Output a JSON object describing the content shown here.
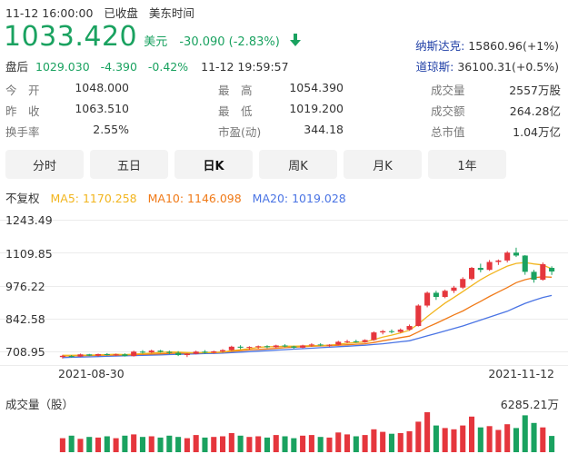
{
  "header": {
    "datetime": "11-12 16:00:00",
    "market_status": "已收盘",
    "timezone": "美东时间",
    "price": "1033.420",
    "currency": "美元",
    "change": "-30.090 (-2.83%)",
    "after_label": "盘后",
    "after_price": "1029.030",
    "after_change": "-4.390",
    "after_pct": "-0.42%",
    "after_time": "11-12 19:59:57"
  },
  "indices": [
    {
      "name": "纳斯达克:",
      "value": "15860.96(+1%)"
    },
    {
      "name": "道琼斯:",
      "value": "36100.31(+0.5%)"
    }
  ],
  "stats": {
    "open_label": "今　开",
    "open": "1048.000",
    "high_label": "最　高",
    "high": "1054.390",
    "volume_label": "成交量",
    "volume": "2557万股",
    "prev_label": "昨　收",
    "prev": "1063.510",
    "low_label": "最　低",
    "low": "1019.200",
    "amount_label": "成交额",
    "amount": "264.28亿",
    "turnover_label": "换手率",
    "turnover": "2.55%",
    "pe_label": "市盈(动)",
    "pe": "344.18",
    "mcap_label": "总市值",
    "mcap": "1.04万亿"
  },
  "tabs": [
    "分时",
    "五日",
    "日K",
    "周K",
    "月K",
    "1年"
  ],
  "active_tab": "日K",
  "ma_bar": {
    "adjust": "不复权",
    "ma5": "MA5: 1170.258",
    "ma10": "MA10: 1146.098",
    "ma20": "MA20: 1019.028"
  },
  "colors": {
    "up": "#e5363d",
    "down": "#1aa260",
    "ma5": "#f2b51e",
    "ma10": "#f07a18",
    "ma20": "#4a74e4"
  },
  "chart_data": {
    "type": "candlestick",
    "y_ticks": [
      "1243.49",
      "1109.85",
      "976.22",
      "842.58",
      "708.95"
    ],
    "x_labels": [
      "2021-08-30",
      "2021-11-12"
    ],
    "ylim": [
      708.95,
      1243.49
    ],
    "candles": [
      [
        686,
        695,
        680,
        691
      ],
      [
        690,
        694,
        684,
        688
      ],
      [
        688,
        700,
        686,
        697
      ],
      [
        697,
        699,
        690,
        692
      ],
      [
        692,
        700,
        688,
        698
      ],
      [
        698,
        702,
        692,
        695
      ],
      [
        695,
        700,
        690,
        697
      ],
      [
        697,
        701,
        688,
        690
      ],
      [
        690,
        712,
        688,
        708
      ],
      [
        708,
        714,
        700,
        705
      ],
      [
        705,
        716,
        702,
        712
      ],
      [
        712,
        715,
        704,
        707
      ],
      [
        707,
        712,
        698,
        703
      ],
      [
        703,
        710,
        690,
        694
      ],
      [
        694,
        702,
        686,
        699
      ],
      [
        699,
        712,
        697,
        708
      ],
      [
        708,
        714,
        700,
        704
      ],
      [
        704,
        712,
        700,
        709
      ],
      [
        709,
        718,
        704,
        714
      ],
      [
        714,
        732,
        711,
        728
      ],
      [
        728,
        734,
        718,
        724
      ],
      [
        724,
        730,
        716,
        727
      ],
      [
        727,
        733,
        720,
        730
      ],
      [
        730,
        734,
        722,
        726
      ],
      [
        726,
        736,
        722,
        733
      ],
      [
        733,
        738,
        726,
        729
      ],
      [
        729,
        732,
        720,
        724
      ],
      [
        724,
        736,
        722,
        733
      ],
      [
        733,
        742,
        728,
        737
      ],
      [
        737,
        742,
        730,
        734
      ],
      [
        734,
        738,
        728,
        736
      ],
      [
        736,
        752,
        733,
        748
      ],
      [
        748,
        756,
        742,
        750
      ],
      [
        750,
        756,
        744,
        747
      ],
      [
        747,
        758,
        744,
        755
      ],
      [
        755,
        790,
        752,
        786
      ],
      [
        786,
        796,
        778,
        791
      ],
      [
        791,
        798,
        782,
        788
      ],
      [
        788,
        802,
        784,
        797
      ],
      [
        797,
        818,
        793,
        812
      ],
      [
        812,
        900,
        810,
        895
      ],
      [
        895,
        952,
        888,
        947
      ],
      [
        947,
        955,
        918,
        930
      ],
      [
        930,
        960,
        925,
        955
      ],
      [
        955,
        975,
        946,
        968
      ],
      [
        968,
        1010,
        962,
        1003
      ],
      [
        1003,
        1052,
        998,
        1048
      ],
      [
        1048,
        1065,
        1030,
        1040
      ],
      [
        1040,
        1080,
        1036,
        1072
      ],
      [
        1072,
        1082,
        1060,
        1078
      ],
      [
        1078,
        1116,
        1070,
        1110
      ],
      [
        1110,
        1130,
        1092,
        1098
      ],
      [
        1098,
        1100,
        1020,
        1032
      ],
      [
        1032,
        1040,
        988,
        1000
      ],
      [
        1000,
        1070,
        996,
        1063
      ],
      [
        1048,
        1054.39,
        1019.2,
        1033.42
      ]
    ],
    "ma5": [
      693,
      693,
      694,
      694,
      695,
      696,
      697,
      696,
      698,
      700,
      702,
      705,
      707,
      706,
      704,
      703,
      704,
      704,
      706,
      712,
      716,
      720,
      725,
      728,
      728,
      730,
      730,
      731,
      732,
      733,
      734,
      738,
      742,
      745,
      747,
      757,
      767,
      775,
      784,
      795,
      820,
      850,
      878,
      905,
      928,
      952,
      976,
      1000,
      1020,
      1038,
      1055,
      1066,
      1070,
      1064,
      1060,
      1044
    ],
    "ma10": [
      690,
      691,
      692,
      692,
      693,
      694,
      694,
      695,
      696,
      697,
      698,
      699,
      701,
      702,
      702,
      703,
      704,
      705,
      706,
      709,
      712,
      715,
      717,
      719,
      721,
      724,
      726,
      728,
      730,
      731,
      732,
      734,
      736,
      738,
      740,
      745,
      752,
      758,
      765,
      771,
      788,
      807,
      823,
      840,
      857,
      873,
      893,
      912,
      932,
      950,
      968,
      988,
      1000,
      1008,
      1012,
      1010
    ],
    "ma20": [
      684,
      685,
      686,
      687,
      688,
      689,
      690,
      691,
      692,
      693,
      694,
      695,
      696,
      697,
      698,
      699,
      700,
      701,
      702,
      704,
      706,
      708,
      710,
      712,
      714,
      716,
      718,
      720,
      722,
      724,
      726,
      728,
      730,
      732,
      734,
      737,
      740,
      744,
      748,
      752,
      762,
      772,
      782,
      792,
      802,
      812,
      824,
      836,
      848,
      860,
      872,
      888,
      904,
      916,
      928,
      936
    ],
    "volume_label": "成交量（股）",
    "volume_max": "6285.21万",
    "volumes": [
      2200,
      2600,
      2100,
      2400,
      2300,
      2500,
      2200,
      2600,
      2800,
      2400,
      2500,
      2300,
      2600,
      2400,
      2200,
      2700,
      2300,
      2400,
      2500,
      3000,
      2600,
      2400,
      2500,
      2300,
      2700,
      2500,
      2200,
      2600,
      2700,
      2400,
      2300,
      3100,
      2800,
      2500,
      2700,
      3600,
      3200,
      2900,
      3000,
      3300,
      4800,
      6285,
      4200,
      3800,
      3600,
      4200,
      5600,
      3900,
      4100,
      3500,
      4400,
      3800,
      5800,
      4600,
      3900,
      2557
    ]
  }
}
